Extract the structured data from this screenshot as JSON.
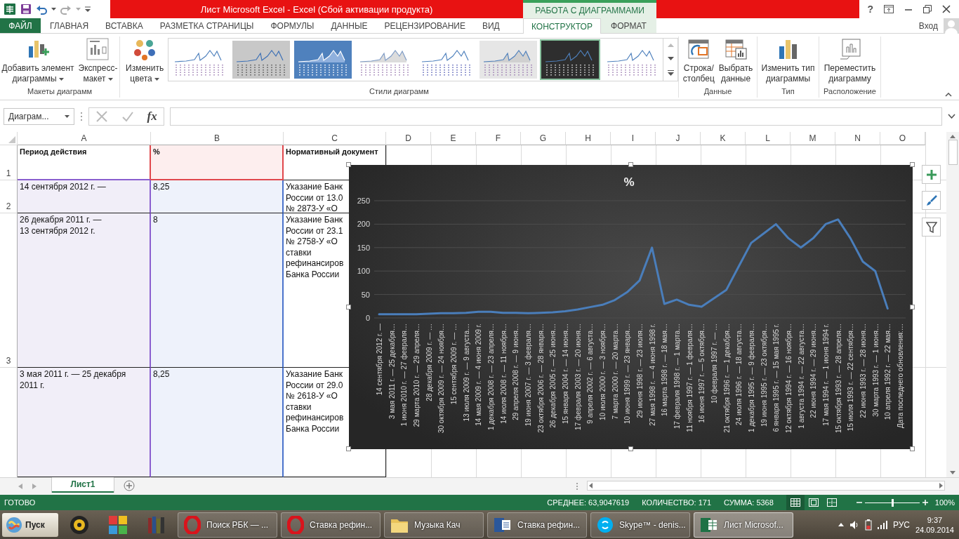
{
  "title_bar": {
    "title": "Лист Microsoft Excel -  Excel (Сбой активации продукта)",
    "context_header": "РАБОТА С ДИАГРАММАМИ",
    "help": "?"
  },
  "tabs": [
    {
      "label": "ФАЙЛ",
      "kind": "file",
      "selected": false
    },
    {
      "label": "ГЛАВНАЯ",
      "kind": "normal",
      "selected": false
    },
    {
      "label": "ВСТАВКА",
      "kind": "normal",
      "selected": false
    },
    {
      "label": "РАЗМЕТКА СТРАНИЦЫ",
      "kind": "normal",
      "selected": false
    },
    {
      "label": "ФОРМУЛЫ",
      "kind": "normal",
      "selected": false
    },
    {
      "label": "ДАННЫЕ",
      "kind": "normal",
      "selected": false
    },
    {
      "label": "РЕЦЕНЗИРОВАНИЕ",
      "kind": "normal",
      "selected": false
    },
    {
      "label": "ВИД",
      "kind": "normal",
      "selected": false
    },
    {
      "label": "КОНСТРУКТОР",
      "kind": "contextual",
      "selected": true
    },
    {
      "label": "ФОРМАТ",
      "kind": "contextual",
      "selected": false
    }
  ],
  "account": {
    "label": "Вход"
  },
  "ribbon": {
    "layouts": {
      "label": "Макеты диаграмм",
      "buttons": [
        {
          "lines": [
            "Добавить элемент",
            "диаграммы"
          ],
          "dropdown": true
        },
        {
          "lines": [
            "Экспресс-",
            "макет"
          ],
          "dropdown": true
        }
      ]
    },
    "styles": {
      "label": "Стили диаграмм",
      "colors_button": {
        "lines": [
          "Изменить",
          "цвета"
        ],
        "dropdown": true
      },
      "gallery": [
        {
          "kind": "plain",
          "selected": false
        },
        {
          "kind": "gray",
          "selected": false
        },
        {
          "kind": "blue",
          "selected": false
        },
        {
          "kind": "shaded",
          "selected": false
        },
        {
          "kind": "dotted",
          "selected": false
        },
        {
          "kind": "hatched",
          "selected": false
        },
        {
          "kind": "dark",
          "selected": true
        },
        {
          "kind": "markers",
          "selected": false
        }
      ]
    },
    "data": {
      "label": "Данные",
      "buttons": [
        {
          "lines": [
            "Строка/",
            "столбец"
          ],
          "dropdown": false
        },
        {
          "lines": [
            "Выбрать",
            "данные"
          ],
          "dropdown": false
        }
      ]
    },
    "type": {
      "label": "Тип",
      "buttons": [
        {
          "lines": [
            "Изменить тип",
            "диаграммы"
          ],
          "dropdown": false
        }
      ]
    },
    "location": {
      "label": "Расположение",
      "buttons": [
        {
          "lines": [
            "Переместить",
            "диаграмму"
          ],
          "dropdown": false
        }
      ]
    }
  },
  "formula_bar": {
    "name_box": "Диаграм...",
    "fx": "fx"
  },
  "sheet": {
    "columns": [
      "A",
      "B",
      "C",
      "D",
      "E",
      "F",
      "G",
      "H",
      "I",
      "J",
      "K",
      "L",
      "M",
      "N",
      "O"
    ],
    "rows": [
      {
        "number": "1",
        "header": true,
        "cells": [
          {
            "lines": [
              "Период действия"
            ]
          },
          {
            "lines": [
              "%"
            ]
          },
          {
            "lines": [
              "Нормативный документ"
            ]
          }
        ]
      },
      {
        "number": "2",
        "header": false,
        "cells": [
          {
            "lines": [
              "14 сентября 2012 г. —"
            ]
          },
          {
            "lines": [
              "8,25"
            ]
          },
          {
            "lines": [
              "Указание Банк",
              "России от 13.0",
              "№ 2873-У «О"
            ]
          }
        ]
      },
      {
        "number": "3",
        "header": false,
        "cells": [
          {
            "lines": [
              "26 декабря 2011 г. —",
              "13 сентября 2012 г."
            ]
          },
          {
            "lines": [
              "8"
            ]
          },
          {
            "lines": [
              "Указание Банк",
              "России от 23.1",
              "№ 2758-У «О",
              "ставки",
              "рефинансиров",
              "Банка России"
            ]
          }
        ]
      },
      {
        "header": false,
        "cells": [
          {
            "lines": [
              "3 мая 2011 г. — 25 декабря",
              "2011 г."
            ]
          },
          {
            "lines": [
              "8,25"
            ]
          },
          {
            "lines": [
              "Указание Банк",
              "России от 29.0",
              "№ 2618-У «О",
              "ставки",
              "рефинансиров",
              "Банка России"
            ]
          }
        ]
      }
    ]
  },
  "chart": {
    "chart_data": {
      "type": "line",
      "title": "%",
      "categories": [
        "14 сентября 2012 г. —",
        "3 мая 2011 г. — 25 декабря…",
        "1 июня 2010 г. — 27 февраля…",
        "29 марта 2010 г. — 29 апреля…",
        "28 декабря 2009 г. — …",
        "30 октября 2009 г. — 24 ноября…",
        "15 сентября 2009 г. — …",
        "13 июля 2009 г. — 9 августа…",
        "14 мая 2009 г. — 4 июня 2009 г.",
        "1 декабря 2008 г. — 23 апреля…",
        "14 июля 2008 г. — 11 ноября…",
        "29 апреля 2008 г. — 9 июня…",
        "19 июня 2007 г. — 3 февраля…",
        "23 октября 2006 г. — 28 января…",
        "26 декабря 2005 г. — 25 июня…",
        "15 января 2004 г. — 14 июня…",
        "17 февраля 2003 г. — 20 июня…",
        "9 апреля 2002 г. — 6 августа…",
        "10 июля 2000 г. — 3 ноября…",
        "7 марта 2000 г. — 20 марта…",
        "10 июня 1999 г. — 23 января…",
        "29 июня 1998 г. — 23 июля…",
        "27 мая 1998 г. — 4 июня 1998 г.",
        "16 марта 1998 г. — 18 мая…",
        "17 февраля 1998 г. — 1 марта…",
        "11 ноября 1997 г. — 1 февраля…",
        "16 июня 1997 г. — 5 октября…",
        "10 февраля 1997 г. — …",
        "21 октября 1996 г. — 1 декабря…",
        "24 июля 1996 г. — 18 августа…",
        "1 декабря 1995 г. — 9 февраля…",
        "19 июня 1995 г. — 23 октября…",
        "6 января 1995 г. — 15 мая 1995 г.",
        "12 октября 1994 г. — 16 ноября…",
        "1 августа 1994 г. — 22 августа…",
        "22 июня 1994 г. — 29 июня…",
        "17 мая 1994 г. — 1 июня 1994 г.",
        "15 октября 1993 г. — 28 апреля…",
        "15 июля 1993 г. — 22 сентября…",
        "22 июня 1993 г. — 28 июня…",
        "30 марта 1993 г. — 1 июня…",
        "10 апреля 1992 г. — 22 мая…",
        "Дата последнего обновления:…"
      ],
      "series": [
        {
          "color": "#4a7ebb",
          "values": [
            8,
            8,
            8,
            8,
            9,
            10,
            10,
            11,
            13,
            13,
            11,
            11,
            10,
            11,
            12,
            14,
            18,
            23,
            28,
            38,
            55,
            80,
            150,
            30,
            39,
            28,
            24,
            42,
            60,
            110,
            160,
            180,
            200,
            170,
            150,
            170,
            200,
            210,
            170,
            120,
            100,
            20,
            null
          ]
        }
      ],
      "grid": true,
      "ylim": [
        0,
        250
      ],
      "yticks": [
        0,
        50,
        100,
        150,
        200,
        250
      ]
    }
  },
  "sheet_tabs": [
    {
      "label": "Лист1",
      "selected": true
    }
  ],
  "status_bar": {
    "ready": "ГОТОВО",
    "average": "СРЕДНЕЕ: 63,9047619",
    "count": "КОЛИЧЕСТВО: 171",
    "sum": "СУММА: 5368",
    "views": [
      {
        "kind": "normal",
        "selected": true
      },
      {
        "kind": "page_layout",
        "selected": false
      },
      {
        "kind": "page_break",
        "selected": false
      }
    ],
    "zoom": {
      "level": 0.5,
      "reading": "100%"
    }
  },
  "taskbar": {
    "start": "Пуск",
    "pinned": [
      {
        "kind": "media"
      },
      {
        "kind": "puzzle"
      },
      {
        "kind": "books"
      }
    ],
    "windows": [
      {
        "kind": "opera",
        "label": "Поиск РБК — ...",
        "selected": false
      },
      {
        "kind": "opera",
        "label": "Ставка рефин...",
        "selected": false
      },
      {
        "kind": "folder",
        "label": "Музыка Кач",
        "selected": false
      },
      {
        "kind": "word",
        "label": "Ставка рефин...",
        "selected": false
      },
      {
        "kind": "skype",
        "label": "Skype™ - denis...",
        "selected": false
      },
      {
        "kind": "excel",
        "label": "Лист Microsof...",
        "selected": true
      }
    ],
    "language": "РУС",
    "time": "9:37",
    "date": "24.09.2014"
  }
}
